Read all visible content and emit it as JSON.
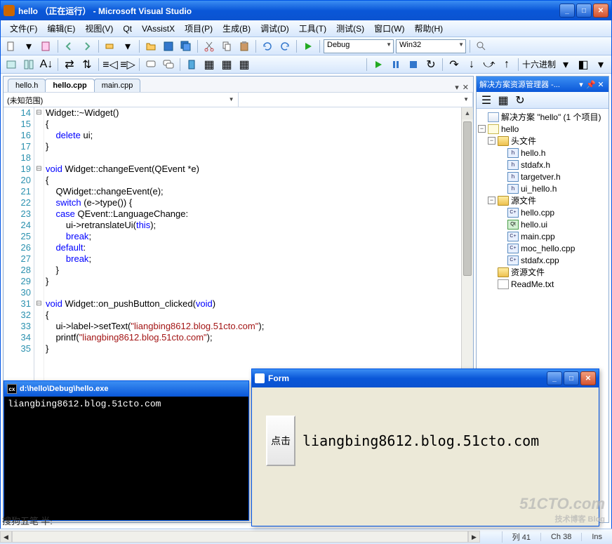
{
  "window": {
    "title": "hello （正在运行） - Microsoft Visual Studio"
  },
  "menu": [
    "文件(F)",
    "编辑(E)",
    "视图(V)",
    "Qt",
    "VAssistX",
    "项目(P)",
    "生成(B)",
    "调试(D)",
    "工具(T)",
    "测试(S)",
    "窗口(W)",
    "帮助(H)"
  ],
  "toolbar2": {
    "debug": "Debug",
    "platform": "Win32"
  },
  "toolbar3": {
    "hex": "十六进制"
  },
  "tabs": [
    {
      "label": "hello.h",
      "active": false
    },
    {
      "label": "hello.cpp",
      "active": true
    },
    {
      "label": "main.cpp",
      "active": false
    }
  ],
  "scope": {
    "left": "(未知范围)",
    "right": ""
  },
  "code": {
    "start": 14,
    "lines": [
      {
        "n": 14,
        "fold": "⊟",
        "html": "Widget::~Widget()"
      },
      {
        "n": 15,
        "fold": "",
        "html": "{"
      },
      {
        "n": 16,
        "fold": "",
        "html": "    <span class='kw'>delete</span> ui;"
      },
      {
        "n": 17,
        "fold": "",
        "html": "}"
      },
      {
        "n": 18,
        "fold": "",
        "html": ""
      },
      {
        "n": 19,
        "fold": "⊟",
        "html": "<span class='kw'>void</span> Widget::changeEvent(QEvent *e)"
      },
      {
        "n": 20,
        "fold": "",
        "html": "{"
      },
      {
        "n": 21,
        "fold": "",
        "html": "    QWidget::changeEvent(e);"
      },
      {
        "n": 22,
        "fold": "",
        "html": "    <span class='kw'>switch</span> (e-&gt;type()) {"
      },
      {
        "n": 23,
        "fold": "",
        "html": "    <span class='kw'>case</span> QEvent::LanguageChange:"
      },
      {
        "n": 24,
        "fold": "",
        "html": "        ui-&gt;retranslateUi(<span class='kw'>this</span>);"
      },
      {
        "n": 25,
        "fold": "",
        "html": "        <span class='kw'>break</span>;"
      },
      {
        "n": 26,
        "fold": "",
        "html": "    <span class='kw'>default</span>:"
      },
      {
        "n": 27,
        "fold": "",
        "html": "        <span class='kw'>break</span>;"
      },
      {
        "n": 28,
        "fold": "",
        "html": "    }"
      },
      {
        "n": 29,
        "fold": "",
        "html": "}"
      },
      {
        "n": 30,
        "fold": "",
        "html": ""
      },
      {
        "n": 31,
        "fold": "⊟",
        "html": "<span class='kw'>void</span> Widget::on_pushButton_clicked(<span class='kw'>void</span>)"
      },
      {
        "n": 32,
        "fold": "",
        "html": "{"
      },
      {
        "n": 33,
        "fold": "",
        "html": "    ui-&gt;label-&gt;setText(<span class='str'>\"liangbing8612.blog.51cto.com\"</span>);"
      },
      {
        "n": 34,
        "fold": "",
        "html": "    printf(<span class='str'>\"liangbing8612.blog.51cto.com\"</span>);"
      },
      {
        "n": 35,
        "fold": "",
        "html": "}"
      }
    ]
  },
  "solution": {
    "panel_title": "解决方案资源管理器 -...",
    "root": "解决方案 \"hello\" (1 个项目)",
    "project": "hello",
    "headers_folder": "头文件",
    "headers": [
      "hello.h",
      "stdafx.h",
      "targetver.h",
      "ui_hello.h"
    ],
    "sources_folder": "源文件",
    "sources": [
      {
        "n": "hello.cpp",
        "t": "cpp"
      },
      {
        "n": "hello.ui",
        "t": "ui"
      },
      {
        "n": "main.cpp",
        "t": "cpp"
      },
      {
        "n": "moc_hello.cpp",
        "t": "cpp"
      },
      {
        "n": "stdafx.cpp",
        "t": "cpp"
      }
    ],
    "resources_folder": "资源文件",
    "readme": "ReadMe.txt"
  },
  "console": {
    "title": "d:\\hello\\Debug\\hello.exe",
    "output": "liangbing8612.blog.51cto.com"
  },
  "form": {
    "title": "Form",
    "button": "点击",
    "label": "liangbing8612.blog.51cto.com"
  },
  "ime": "搜狗五笔 半:",
  "status": {
    "col": "列 41",
    "ch": "Ch 38",
    "ins": "Ins"
  },
  "watermark": {
    "main": "51CTO.com",
    "sub": "技术博客  Blog"
  }
}
